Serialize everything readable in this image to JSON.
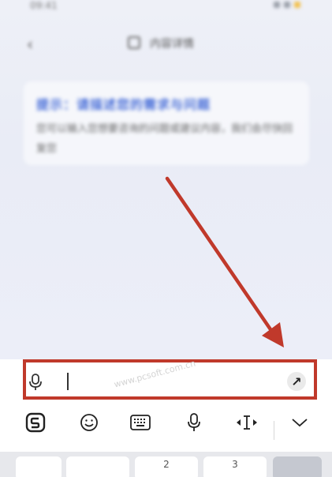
{
  "status_bar": {
    "time": "09:41",
    "icons": [
      "signal-icon",
      "wifi-icon",
      "battery-icon"
    ]
  },
  "topbar": {
    "back_icon": "back-arrow-icon",
    "title": "内容详情"
  },
  "card": {
    "title": "提示：请描述您的需求与问题",
    "text": "您可以输入您想要咨询的问题或建议内容，我们会尽快回复您"
  },
  "input_bar": {
    "value": "",
    "placeholder": "",
    "watermark": "www.pcsoft.com.cn",
    "mic_icon": "microphone-icon",
    "send_icon": "send-arrow-icon",
    "highlight_color": "#c0392b"
  },
  "keyboard": {
    "toolbar": [
      {
        "name": "sogou-logo-icon"
      },
      {
        "name": "emoji-icon"
      },
      {
        "name": "keyboard-icon"
      },
      {
        "name": "voice-input-icon"
      },
      {
        "name": "cursor-move-icon"
      },
      {
        "name": "collapse-keyboard-icon"
      }
    ],
    "keys": [
      {
        "label": ""
      },
      {
        "label": ""
      },
      {
        "label": "2"
      },
      {
        "label": "3"
      },
      {
        "label": ""
      }
    ]
  },
  "annotation": {
    "arrow_color": "#c0392b"
  }
}
